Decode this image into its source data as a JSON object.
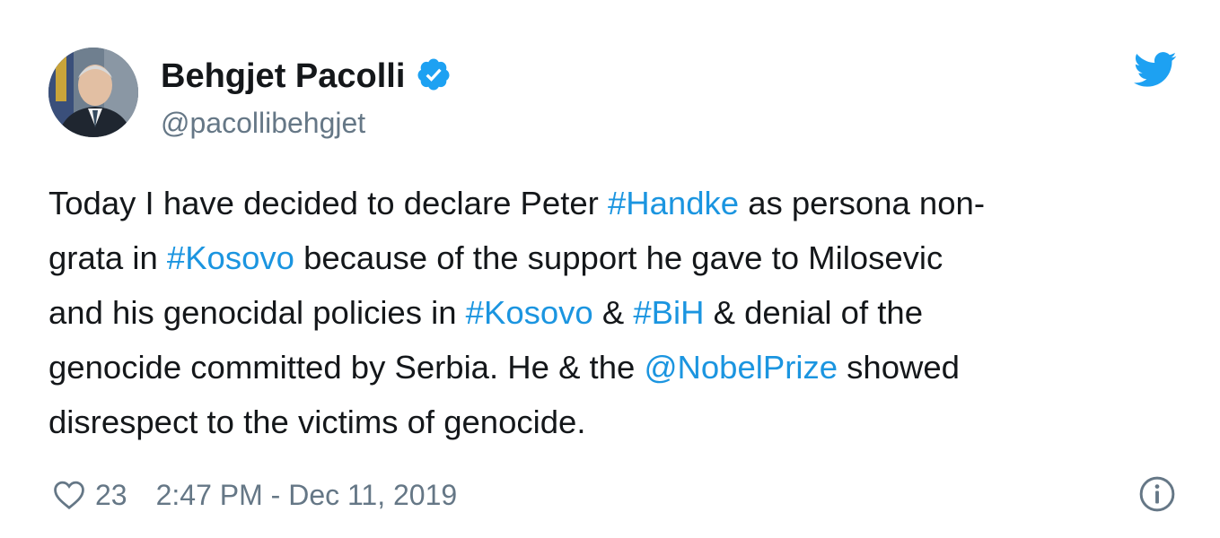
{
  "user": {
    "display_name": "Behgjet Pacolli",
    "handle": "@pacollibehgjet",
    "verified": true
  },
  "tweet": {
    "lines": [
      [
        {
          "text": "Today I have decided to declare Peter ",
          "type": "text"
        },
        {
          "text": "#Handke",
          "type": "link"
        },
        {
          "text": " as persona non-",
          "type": "text"
        }
      ],
      [
        {
          "text": "grata in ",
          "type": "text"
        },
        {
          "text": "#Kosovo",
          "type": "link"
        },
        {
          "text": " because of the support he gave to Milosevic",
          "type": "text"
        }
      ],
      [
        {
          "text": "and his genocidal policies in ",
          "type": "text"
        },
        {
          "text": "#Kosovo",
          "type": "link"
        },
        {
          "text": " & ",
          "type": "text"
        },
        {
          "text": "#BiH",
          "type": "link"
        },
        {
          "text": " & denial of the",
          "type": "text"
        }
      ],
      [
        {
          "text": "genocide committed by Serbia. He & the ",
          "type": "text"
        },
        {
          "text": "@NobelPrize",
          "type": "link"
        },
        {
          "text": " showed",
          "type": "text"
        }
      ],
      [
        {
          "text": "disrespect to the victims of genocide.",
          "type": "text"
        }
      ]
    ]
  },
  "footer": {
    "like_count": "23",
    "timestamp": "2:47 PM - Dec 11, 2019"
  },
  "icons": {
    "heart": "heart-icon",
    "info": "info-icon",
    "verified": "verified-badge-icon",
    "brand": "twitter-logo-icon"
  },
  "colors": {
    "link": "#1b95e0",
    "text": "#14171a",
    "muted": "#657786",
    "brand": "#1da1f2"
  }
}
